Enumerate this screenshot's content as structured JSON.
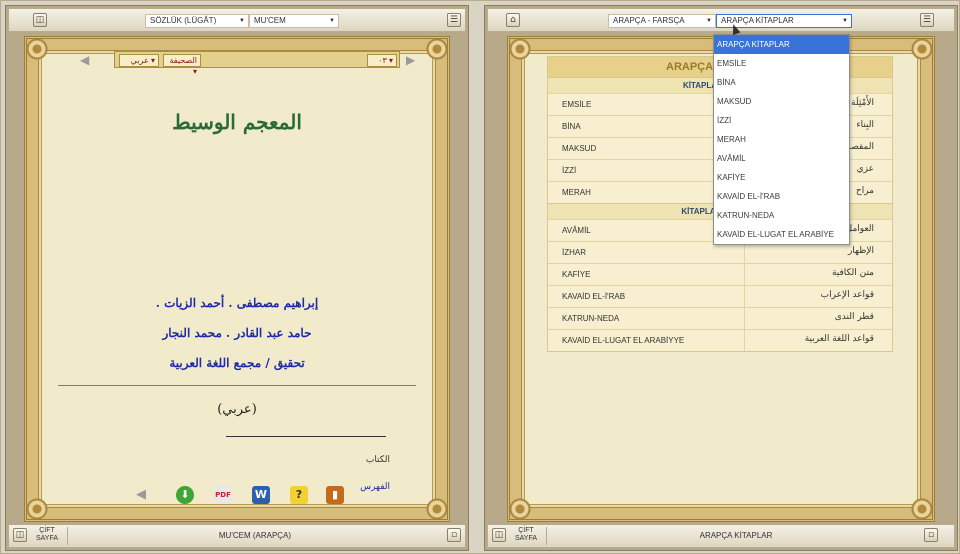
{
  "left_panel": {
    "dictionary_select": "SÖZLÜK (LÜGÂT)",
    "book_select": "MU'CEM",
    "page_nav": {
      "lang_select": "عربي",
      "section_select": "الصحيفة",
      "page_select": "۰۳"
    },
    "book_title": "المعجم الوسيط",
    "authors": [
      "إبراهيم مصطفى . أحمد الزيات .",
      "حامد عبد القادر . محمد النجار",
      "تحقيق / مجمع اللغة العربية"
    ],
    "language_label": "(عربي)",
    "link_book": "الكتاب",
    "link_index": "الفهرس",
    "toolbar_icons": [
      "back-arrow-icon",
      "download-icon",
      "pdf-icon",
      "word-icon",
      "help-icon",
      "book-icon"
    ],
    "bottom_toggle": "ÇİFT SAYFA",
    "bottom_title": "MU'CEM (ARAPÇA)"
  },
  "right_panel": {
    "language_select": "ARAPÇA - FARSÇA",
    "books_select": "ARAPÇA KİTAPLAR",
    "table_header": "ARAPÇA",
    "sections": [
      {
        "title": "KİTAPLAR - (SARF)",
        "rows": [
          {
            "tr": "EMSİLE",
            "ar": "الأَمْثِلَة"
          },
          {
            "tr": "BİNA",
            "ar": "البِناء"
          },
          {
            "tr": "MAKSUD",
            "ar": "المقصود"
          },
          {
            "tr": "İZZİ",
            "ar": "عزي"
          },
          {
            "tr": "MERAH",
            "ar": "مراح"
          }
        ]
      },
      {
        "title": "KİTAPLAR - (NAHİV)",
        "rows": [
          {
            "tr": "AVÂMİL",
            "ar": "العوامل"
          },
          {
            "tr": "İZHAR",
            "ar": "الإظهار"
          },
          {
            "tr": "KAFİYE",
            "ar": "متن الكافية"
          },
          {
            "tr": "KAVAİD EL-İ'RAB",
            "ar": "قواعد الإعراب"
          },
          {
            "tr": "KATRUN-NEDA",
            "ar": "قطر الندى"
          },
          {
            "tr": "KAVAİD EL-LUGAT EL ARABİYYE",
            "ar": "قواعد اللغة العربية"
          }
        ]
      }
    ],
    "dropdown_options": [
      "ARAPÇA KİTAPLAR",
      "EMSİLE",
      "BİNA",
      "MAKSUD",
      "İZZİ",
      "MERAH",
      "AVÂMİL",
      "KAFİYE",
      "KAVAİD EL-İ'RAB",
      "KATRUN-NEDA",
      "KAVAİD EL-LUGAT EL ARABİYE"
    ],
    "dropdown_selected_index": 0,
    "bottom_toggle": "ÇİFT SAYFA",
    "bottom_title": "ARAPÇA KİTAPLAR"
  },
  "colors": {
    "page_bg": "#f2ebcb",
    "ornament": "#d8bd7a",
    "title_green": "#2a6a38",
    "author_blue": "#1f2aa8",
    "selected_option": "#3874d8"
  }
}
